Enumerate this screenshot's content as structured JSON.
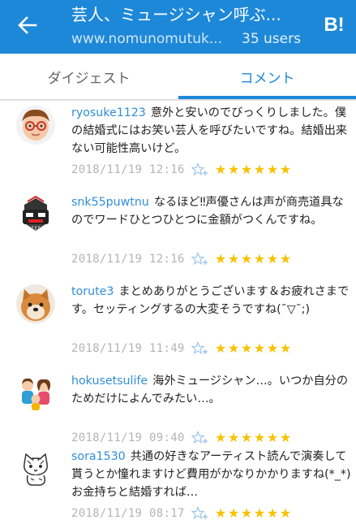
{
  "header": {
    "title": "芸人、ミュージシャン呼ぶ...",
    "url": "www.nomunomutuk...",
    "users": "35 users",
    "bookmark_label": "B!"
  },
  "tabs": [
    {
      "label": "ダイジェスト",
      "active": false
    },
    {
      "label": "コメント",
      "active": true
    }
  ],
  "colors": {
    "accent": "#1e88d8",
    "star": "#f7c100",
    "username": "#2f8ed6",
    "date": "#b4b4b4"
  },
  "comments": [
    {
      "user": "ryosuke1123",
      "text": "意外と安いのでびっくりしました。僕の結婚式にはお笑い芸人を呼びたいですね。結婚出来ない可能性高いけど。",
      "date": "2018/11/19 12:16",
      "stars": 6,
      "avatar_icon": "boy-glasses-avatar"
    },
    {
      "user": "snk55puwtnu",
      "text": "なるほど‼声優さんは声が商売道具なのでワードひとつひとつに金額がつくんですね。",
      "date": "2018/11/19 12:16",
      "stars": 6,
      "avatar_icon": "robot-avatar"
    },
    {
      "user": "torute3",
      "text": "まとめありがとうございます＆お疲れさまです。セッティングするの大変そうですね(¯▽¯;)",
      "date": "2018/11/19 11:49",
      "stars": 6,
      "avatar_icon": "shiba-dog-avatar"
    },
    {
      "user": "hokusetsulife",
      "text": "海外ミュージシャン…。いつか自分のためだけによんでみたい…。",
      "date": "2018/11/19 09:40",
      "stars": 6,
      "avatar_icon": "family-avatar"
    },
    {
      "user": "sora1530",
      "text": "共通の好きなアーティスト読んで演奏して貰うとか憧れますけど費用がかなりかかりますね(*_*)  お金持ちと結婚すれば…",
      "date": "2018/11/19 08:17",
      "stars": 6,
      "avatar_icon": "cat-sketch-avatar"
    }
  ]
}
